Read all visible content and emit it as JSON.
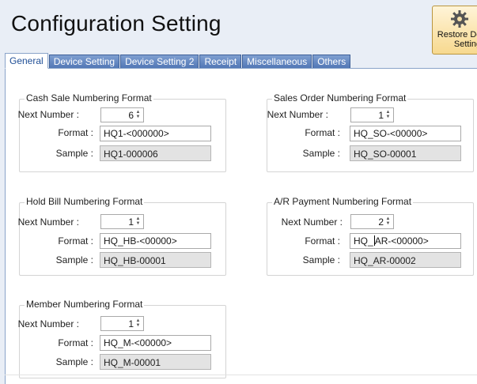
{
  "page": {
    "title": "Configuration Setting"
  },
  "restore_button": {
    "label": "Restore Default Setting",
    "icon": "gear-icon"
  },
  "tabs": [
    {
      "label": "General",
      "active": true
    },
    {
      "label": "Device Setting",
      "active": false
    },
    {
      "label": "Device Setting 2",
      "active": false
    },
    {
      "label": "Receipt",
      "active": false
    },
    {
      "label": "Miscellaneous",
      "active": false
    },
    {
      "label": "Others",
      "active": false
    }
  ],
  "labels": {
    "next_number": "Next Number :",
    "format": "Format :",
    "sample": "Sample :"
  },
  "groups": {
    "cash_sale": {
      "title": "Cash Sale Numbering Format",
      "next_number": "6",
      "format": "HQ1-<000000>",
      "sample": "HQ1-000006"
    },
    "sales_order": {
      "title": "Sales Order Numbering Format",
      "next_number": "1",
      "format": "HQ_SO-<00000>",
      "sample": "HQ_SO-00001"
    },
    "hold_bill": {
      "title": "Hold Bill Numbering Format",
      "next_number": "1",
      "format": "HQ_HB-<00000>",
      "sample": "HQ_HB-00001"
    },
    "ar_payment": {
      "title": "A/R Payment Numbering Format",
      "next_number": "2",
      "format_before_caret": "HQ_",
      "format_after_caret": "AR-<00000>",
      "sample": "HQ_AR-00002"
    },
    "member": {
      "title": "Member Numbering Format",
      "next_number": "1",
      "format": "HQ_M-<00000>",
      "sample": "HQ_M-00001"
    }
  },
  "colors": {
    "background": "#e9eef6",
    "tab_blue": "#4f75b4",
    "active_tab_text": "#1f4e96",
    "restore_button_bg": "#f7d98f"
  }
}
